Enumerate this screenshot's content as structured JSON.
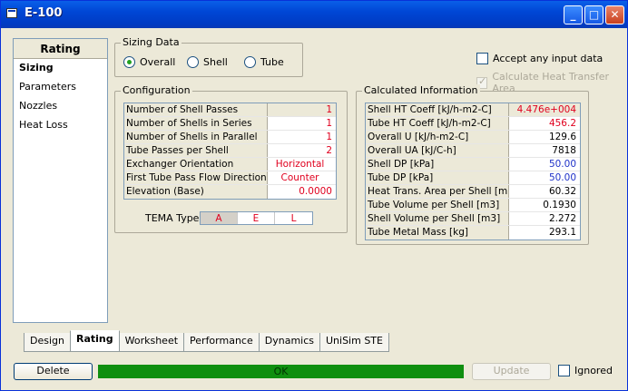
{
  "window": {
    "title": "E-100"
  },
  "left_panel": {
    "header": "Rating",
    "items": [
      "Sizing",
      "Parameters",
      "Nozzles",
      "Heat Loss"
    ]
  },
  "sizing_data": {
    "title": "Sizing Data",
    "options": [
      "Overall",
      "Shell",
      "Tube"
    ],
    "selected": "Overall"
  },
  "accept_any_input": {
    "label": "Accept any input data",
    "checked": false
  },
  "calc_heat_transfer": {
    "label": "Calculate Heat Transfer Area",
    "checked": true,
    "disabled": true
  },
  "configuration": {
    "title": "Configuration",
    "rows": [
      {
        "label": "Number of Shell Passes",
        "value": "1"
      },
      {
        "label": "Number of Shells in Series",
        "value": "1"
      },
      {
        "label": "Number of Shells in Parallel",
        "value": "1"
      },
      {
        "label": "Tube Passes per Shell",
        "value": "2"
      },
      {
        "label": "Exchanger Orientation",
        "value": "Horizontal"
      },
      {
        "label": "First Tube Pass Flow Direction",
        "value": "Counter"
      },
      {
        "label": "Elevation (Base)",
        "value": "0.0000"
      }
    ],
    "tema_label": "TEMA Type",
    "tema": [
      "A",
      "E",
      "L"
    ]
  },
  "calculated": {
    "title": "Calculated Information",
    "rows": [
      {
        "label": "Shell HT Coeff [kJ/h-m2-C]",
        "value": "4.476e+004",
        "color": "#e0001e"
      },
      {
        "label": "Tube HT Coeff [kJ/h-m2-C]",
        "value": "456.2",
        "color": "#e0001e"
      },
      {
        "label": "Overall U [kJ/h-m2-C]",
        "value": "129.6",
        "color": "#000000"
      },
      {
        "label": "Overall UA [kJ/C-h]",
        "value": "7818",
        "color": "#000000"
      },
      {
        "label": "Shell DP [kPa]",
        "value": "50.00",
        "color": "#1f32c8"
      },
      {
        "label": "Tube DP [kPa]",
        "value": "50.00",
        "color": "#1f32c8"
      },
      {
        "label": "Heat Trans. Area per Shell [m2]",
        "value": "60.32",
        "color": "#000000"
      },
      {
        "label": "Tube Volume per Shell [m3]",
        "value": "0.1930",
        "color": "#000000"
      },
      {
        "label": "Shell Volume per Shell [m3]",
        "value": "2.272",
        "color": "#000000"
      },
      {
        "label": "Tube Metal Mass [kg]",
        "value": "293.1",
        "color": "#000000"
      }
    ]
  },
  "tabs": [
    "Design",
    "Rating",
    "Worksheet",
    "Performance",
    "Dynamics",
    "UniSim STE"
  ],
  "active_tab": "Rating",
  "footer": {
    "delete_label": "Delete",
    "status_text": "OK",
    "update_label": "Update",
    "ignored_label": "Ignored",
    "ignored_checked": false
  },
  "colors": {
    "status_ok": "#0f8f0f",
    "specified_value": "#e0001e",
    "default_value": "#1f32c8"
  }
}
